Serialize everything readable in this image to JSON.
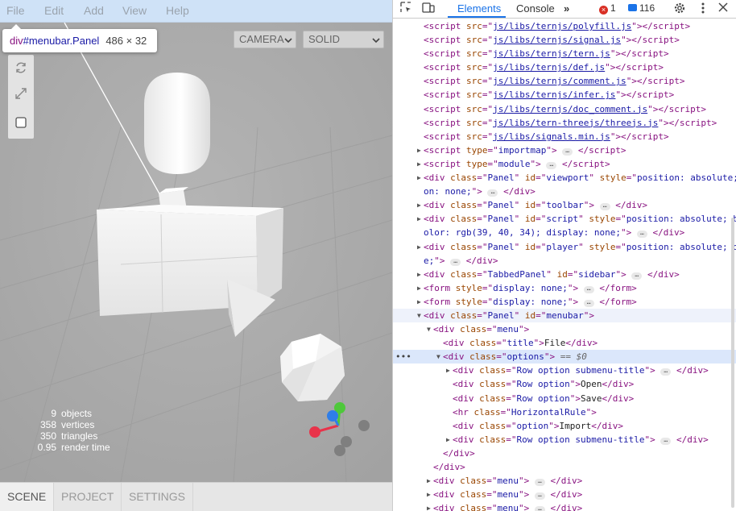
{
  "menubar": {
    "items": [
      "File",
      "Edit",
      "Add",
      "View",
      "Help"
    ]
  },
  "viewport": {
    "camera_select": "CAMERA",
    "shading_select": "SOLID"
  },
  "tooltip": {
    "name": "div",
    "selector": "#menubar.Panel",
    "size": "486 × 32"
  },
  "info": {
    "rows": [
      {
        "value": "9",
        "label": "objects"
      },
      {
        "value": "358",
        "label": "vertices"
      },
      {
        "value": "350",
        "label": "triangles"
      },
      {
        "value": "0.95",
        "label": "render time"
      }
    ]
  },
  "bottom_tabs": [
    "SCENE",
    "PROJECT",
    "SETTINGS"
  ],
  "devtools": {
    "tabs": {
      "elements": "Elements",
      "console": "Console",
      "more": "»"
    },
    "errors": "1",
    "messages": "116",
    "colors": {
      "accent": "#1a73e8",
      "tag": "#881280",
      "attr_name": "#994500",
      "attr_value": "#1a1aa6",
      "error": "#d93025"
    },
    "script_srcs": [
      "js/libs/ternjs/polyfill.js",
      "js/libs/ternjs/signal.js",
      "js/libs/ternjs/tern.js",
      "js/libs/ternjs/def.js",
      "js/libs/ternjs/comment.js",
      "js/libs/ternjs/infer.js",
      "js/libs/ternjs/doc_comment.js",
      "js/libs/tern-threejs/threejs.js",
      "js/libs/signals.min.js"
    ],
    "text": {
      "importmap": "importmap",
      "module": "module",
      "viewport_style": "position: absolute; touch",
      "viewport_cont": "on: none;",
      "script_style": "position: absolute; backgro",
      "script_cont": "olor: rgb(39, 40, 34); display: none;",
      "player_style": "position: absolute; display",
      "player_cont": "e;",
      "form_style": "display: none;",
      "dollar": "== $0",
      "file_text": "File",
      "open_text": "Open",
      "save_text": "Save",
      "import_text": "Import"
    }
  }
}
